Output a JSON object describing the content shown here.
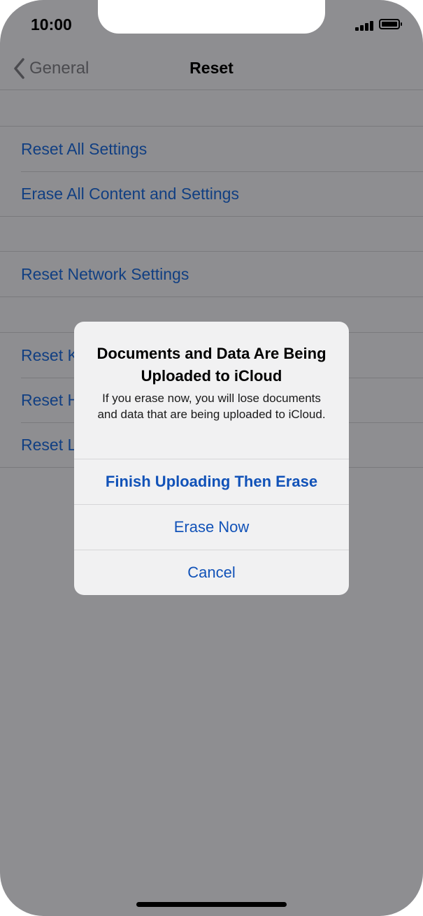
{
  "status_bar": {
    "time": "10:00",
    "signal_icon": "signal-bars-icon",
    "battery_icon": "battery-icon"
  },
  "nav": {
    "back_label": "General",
    "back_icon": "chevron-left-icon",
    "title": "Reset"
  },
  "groups": [
    {
      "items": [
        "Reset All Settings",
        "Erase All Content and Settings"
      ]
    },
    {
      "items": [
        "Reset Network Settings"
      ]
    },
    {
      "items": [
        "Reset Keyboard Dictionary",
        "Reset Home Screen Layout",
        "Reset Location & Privacy"
      ]
    }
  ],
  "alert": {
    "title": "Documents and Data Are Being Uploaded to iCloud",
    "message": "If you erase now, you will lose documents and data that are being uploaded to iCloud.",
    "buttons": [
      "Finish Uploading Then Erase",
      "Erase Now",
      "Cancel"
    ]
  },
  "colors": {
    "dim_background": "#8e8e91",
    "link": "#113f82",
    "alert_button": "#1152b8"
  }
}
